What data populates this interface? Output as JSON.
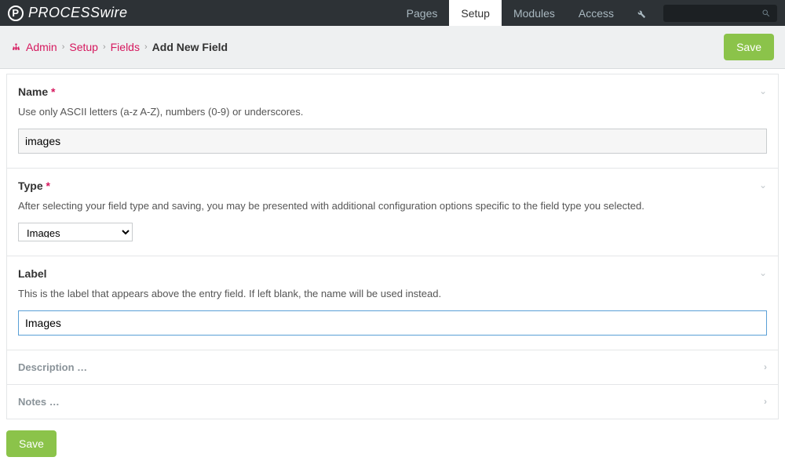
{
  "brand": {
    "name": "PROCESSwire"
  },
  "topnav": {
    "pages": "Pages",
    "setup": "Setup",
    "modules": "Modules",
    "access": "Access"
  },
  "breadcrumbs": {
    "admin": "Admin",
    "setup": "Setup",
    "fields": "Fields",
    "current": "Add New Field"
  },
  "buttons": {
    "save_top": "Save",
    "save_bottom": "Save"
  },
  "fields": {
    "name": {
      "label": "Name",
      "required_mark": "*",
      "help": "Use only ASCII letters (a-z A-Z), numbers (0-9) or underscores.",
      "value": "images"
    },
    "type": {
      "label": "Type",
      "required_mark": "*",
      "help": "After selecting your field type and saving, you may be presented with additional configuration options specific to the field type you selected.",
      "value": "Images"
    },
    "label": {
      "label": "Label",
      "help": "This is the label that appears above the entry field. If left blank, the name will be used instead.",
      "value": "Images"
    },
    "description": {
      "label": "Description …"
    },
    "notes": {
      "label": "Notes …"
    }
  }
}
